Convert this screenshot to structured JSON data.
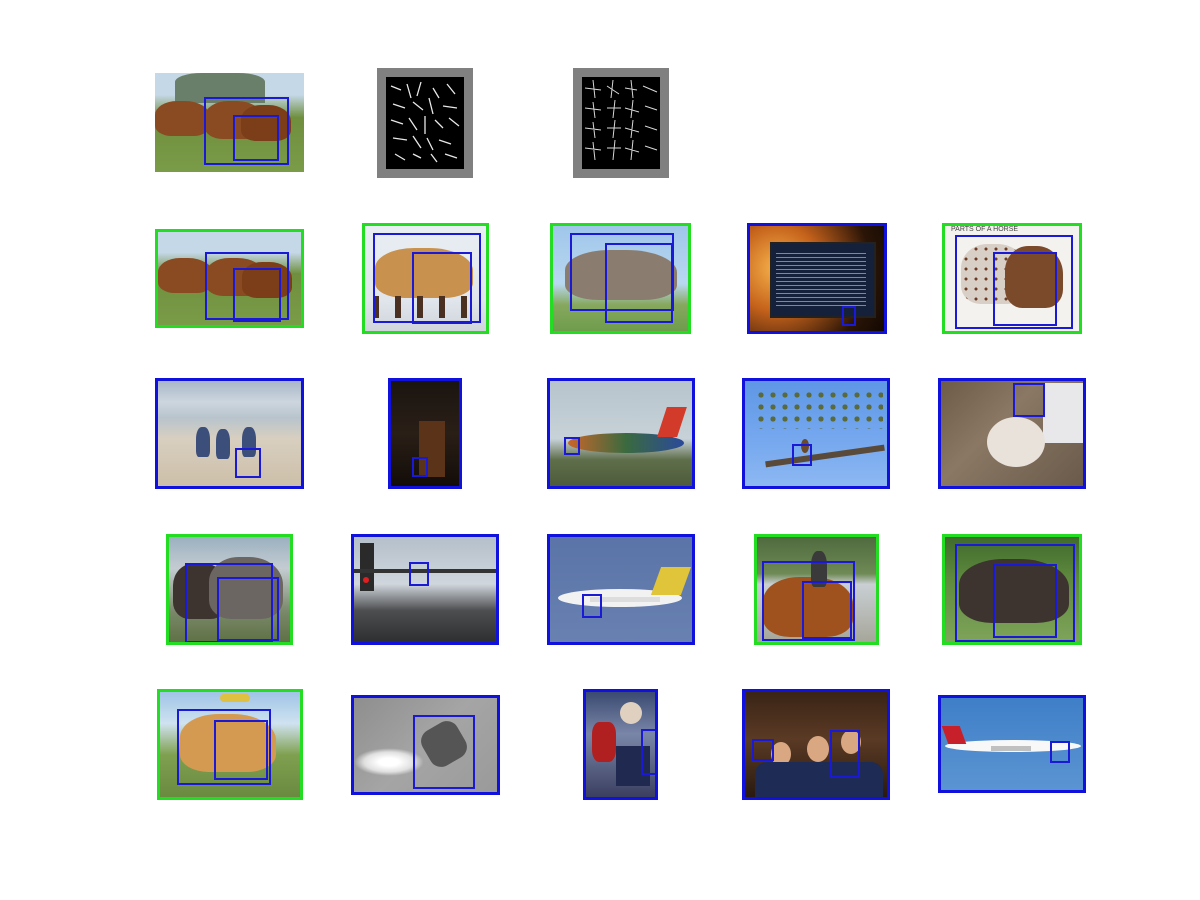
{
  "figure": {
    "rows": [
      {
        "cells": [
          {
            "kind": "image",
            "frame": "none",
            "scene": "field",
            "name": "query-image-horses"
          },
          {
            "kind": "hog",
            "name": "hog-template-root"
          },
          {
            "kind": "hog",
            "name": "hog-template-parts"
          }
        ]
      },
      {
        "cells": [
          {
            "kind": "image",
            "frame": "green",
            "scene": "field",
            "name": "result-horses-field"
          },
          {
            "kind": "image",
            "frame": "green",
            "scene": "studio",
            "name": "result-horse-studio"
          },
          {
            "kind": "image",
            "frame": "green",
            "scene": "sky",
            "name": "result-horse-gray"
          },
          {
            "kind": "image",
            "frame": "blue",
            "scene": "monitor",
            "name": "result-computer-monitor"
          },
          {
            "kind": "image",
            "frame": "green",
            "scene": "chart",
            "name": "result-horse-parts-chart",
            "caption": "PARTS OF A HORSE"
          }
        ]
      },
      {
        "cells": [
          {
            "kind": "image",
            "frame": "blue",
            "scene": "beach",
            "name": "result-cyclists-beach"
          },
          {
            "kind": "image",
            "frame": "blue",
            "scene": "dark",
            "name": "result-dark-chair"
          },
          {
            "kind": "image",
            "frame": "blue",
            "scene": "plane1",
            "name": "result-airliner-landing"
          },
          {
            "kind": "image",
            "frame": "blue",
            "scene": "tree",
            "name": "result-bird-tree"
          },
          {
            "kind": "image",
            "frame": "blue",
            "scene": "cat",
            "name": "result-cat-floor"
          }
        ]
      },
      {
        "cells": [
          {
            "kind": "image",
            "frame": "green",
            "scene": "fence",
            "name": "result-horses-fence"
          },
          {
            "kind": "image",
            "frame": "blue",
            "scene": "rail",
            "name": "result-railway"
          },
          {
            "kind": "image",
            "frame": "blue",
            "scene": "blue",
            "name": "result-propeller-plane"
          },
          {
            "kind": "image",
            "frame": "green",
            "scene": "arena",
            "name": "result-horse-rider"
          },
          {
            "kind": "image",
            "frame": "green",
            "scene": "pasture",
            "name": "result-horse-dark-pasture"
          }
        ]
      },
      {
        "cells": [
          {
            "kind": "image",
            "frame": "green",
            "scene": "poster",
            "name": "result-horse-poster"
          },
          {
            "kind": "image",
            "frame": "blue",
            "scene": "gray",
            "name": "result-biplane-smoke"
          },
          {
            "kind": "image",
            "frame": "blue",
            "scene": "collage",
            "name": "result-collage"
          },
          {
            "kind": "image",
            "frame": "blue",
            "scene": "party",
            "name": "result-people-party"
          },
          {
            "kind": "image",
            "frame": "blue",
            "scene": "clear",
            "name": "result-airliner-sky"
          }
        ]
      }
    ],
    "colors": {
      "correct_frame": "#22dd22",
      "incorrect_frame": "#1111dd",
      "detection_box": "#1a1ad6",
      "hog_pad": "#808080"
    }
  }
}
